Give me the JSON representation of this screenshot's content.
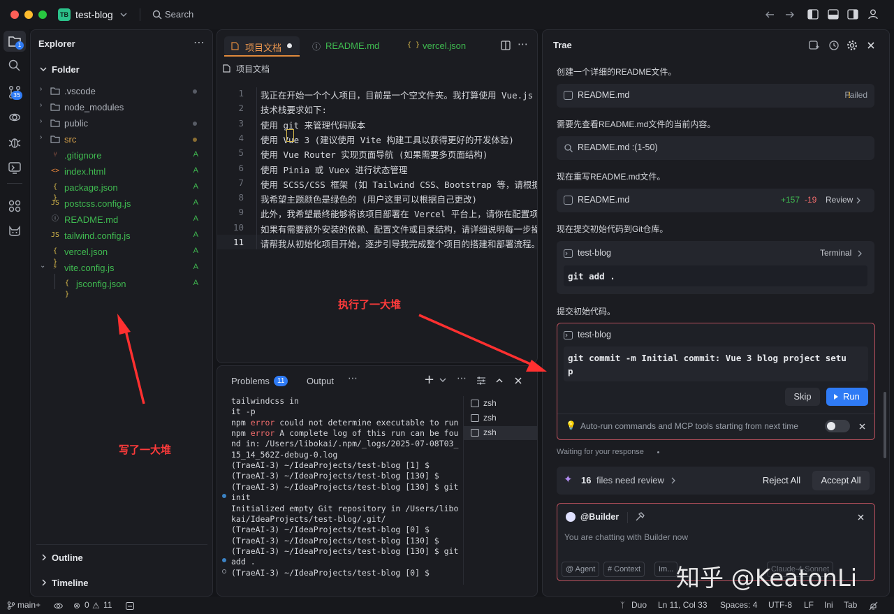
{
  "titlebar": {
    "project_initials": "TB",
    "project_name": "test-blog",
    "search_label": "Search"
  },
  "activity": {
    "explorer_badge": "1",
    "git_badge": "35"
  },
  "explorer": {
    "title": "Explorer",
    "root": "Folder",
    "items": [
      {
        "label": ".vscode",
        "icon": "folder-icon",
        "status": ""
      },
      {
        "label": "node_modules",
        "icon": "folder-icon",
        "status": ""
      },
      {
        "label": "public",
        "icon": "folder-icon",
        "status": ""
      },
      {
        "label": "src",
        "icon": "folder-icon",
        "status": ""
      },
      {
        "label": ".gitignore",
        "icon": "git-icon",
        "status": "A"
      },
      {
        "label": "index.html",
        "icon": "html-icon",
        "status": "A"
      },
      {
        "label": "package.json",
        "icon": "json-icon",
        "status": "A"
      },
      {
        "label": "postcss.config.js",
        "icon": "js-icon",
        "status": "A"
      },
      {
        "label": "README.md",
        "icon": "info-icon",
        "status": "A"
      },
      {
        "label": "tailwind.config.js",
        "icon": "js-icon",
        "status": "A"
      },
      {
        "label": "vercel.json",
        "icon": "json-icon",
        "status": "A"
      },
      {
        "label": "vite.config.js",
        "icon": "vite-icon",
        "status": "A"
      },
      {
        "label": "jsconfig.json",
        "icon": "json-icon",
        "status": "A"
      }
    ],
    "outline": "Outline",
    "timeline": "Timeline",
    "icon_glyphs": {
      "html-icon": "<>",
      "json-icon": "{ }",
      "js-icon": "JS",
      "info-icon": "ⓘ",
      "git-icon": "⑂",
      "vite-icon": "⚡"
    }
  },
  "editor": {
    "tabs": [
      {
        "label": "项目文档"
      },
      {
        "label": "README.md"
      },
      {
        "label": "vercel.json"
      }
    ],
    "breadcrumb": "项目文档",
    "lines": [
      {
        "n": "1",
        "text": "我正在开始一个个人项目，目前是一个空文件夹。我打算使用 Vue.js"
      },
      {
        "n": "2",
        "text": "技术栈要求如下:"
      },
      {
        "n": "3",
        "text": "使用 git 来管理代码版本"
      },
      {
        "n": "4",
        "text": "使用 Vue 3 (建议使用 Vite 构建工具以获得更好的开发体验)"
      },
      {
        "n": "5",
        "text": "使用 Vue Router 实现页面导航 (如果需要多页面结构)"
      },
      {
        "n": "6",
        "text": "使用 Pinia 或 Vuex 进行状态管理"
      },
      {
        "n": "7",
        "text": "使用 SCSS/CSS 框架 (如 Tailwind CSS、Bootstrap 等，请根据"
      },
      {
        "n": "8",
        "text": "我希望主题颜色是绿色的 (用户这里可以根据自己更改)"
      },
      {
        "n": "9",
        "text": "此外，我希望最终能够将该项目部署在 Vercel 平台上，请你在配置项"
      },
      {
        "n": "10",
        "text": "如果有需要额外安装的依赖、配置文件或目录结构，请详细说明每一步操"
      },
      {
        "n": "11",
        "text": "请帮我从初始化项目开始，逐步引导我完成整个项目的搭建和部署流程。"
      }
    ]
  },
  "terminal": {
    "tabs": {
      "problems": "Problems",
      "problems_count": "11",
      "output": "Output"
    },
    "shells": [
      "zsh",
      "zsh",
      "zsh"
    ],
    "lines": [
      {
        "pre": " tailwindcss in",
        "err": "",
        "post": ""
      },
      {
        "pre": "it -p",
        "err": "",
        "post": ""
      },
      {
        "pre": "npm ",
        "err": "error",
        "post": " could not determine executable to run"
      },
      {
        "pre": "npm ",
        "err": "error",
        "post": " A complete log of this run can be fou"
      },
      {
        "pre": "nd in: /Users/libokai/.npm/_logs/2025-07-08T03_",
        "err": "",
        "post": ""
      },
      {
        "pre": "15_14_562Z-debug-0.log",
        "err": "",
        "post": ""
      },
      {
        "pre": "(TraeAI-3) ~/IdeaProjects/test-blog [1] $",
        "err": "",
        "post": ""
      },
      {
        "pre": "(TraeAI-3) ~/IdeaProjects/test-blog [130] $",
        "err": "",
        "post": ""
      },
      {
        "pre": "(TraeAI-3) ~/IdeaProjects/test-blog [130] $ git",
        "err": "",
        "post": ""
      },
      {
        "pre": " init",
        "err": "",
        "post": ""
      },
      {
        "pre": "Initialized empty Git repository in /Users/libo",
        "err": "",
        "post": ""
      },
      {
        "pre": "kai/IdeaProjects/test-blog/.git/",
        "err": "",
        "post": ""
      },
      {
        "pre": "(TraeAI-3) ~/IdeaProjects/test-blog [0] $",
        "err": "",
        "post": ""
      },
      {
        "pre": "(TraeAI-3) ~/IdeaProjects/test-blog [130] $",
        "err": "",
        "post": ""
      },
      {
        "pre": "(TraeAI-3) ~/IdeaProjects/test-blog [130] $ git",
        "err": "",
        "post": ""
      },
      {
        "pre": " add .",
        "err": "",
        "post": ""
      },
      {
        "pre": "(TraeAI-3) ~/IdeaProjects/test-blog [0] $",
        "err": "",
        "post": ""
      }
    ]
  },
  "trae": {
    "title": "Trae",
    "msg1": "创建一个详细的README文件。",
    "card1": {
      "file": "README.md",
      "status": "Failed"
    },
    "msg2": "需要先查看README.md文件的当前内容。",
    "card2": {
      "file": "README.md :(1-50)"
    },
    "msg3": "现在重写README.md文件。",
    "card3": {
      "file": "README.md",
      "added": "+157",
      "removed": "-19",
      "action": "Review"
    },
    "msg4": "现在提交初始代码到Git仓库。",
    "term1": {
      "name": "test-blog",
      "action": "Terminal",
      "command": "git add ."
    },
    "msg5": "提交初始代码。",
    "term2": {
      "name": "test-blog",
      "command_line1": "git commit -m Initial commit: Vue 3 blog project setu",
      "command_line2": "p",
      "skip": "Skip",
      "run": "Run"
    },
    "autorun": "Auto-run commands and MCP tools starting from next time",
    "waiting": "Waiting for your response",
    "review": {
      "count": "16",
      "text": "files need review",
      "reject": "Reject All",
      "accept": "Accept All"
    },
    "chat": {
      "agent": "@Builder",
      "placeholder": "You are chatting with Builder now",
      "chips": [
        "@ Agent",
        "# Context",
        "Im..."
      ],
      "model": "Claude-4-Sonnet"
    }
  },
  "annotations": {
    "left": "写了一大堆",
    "middle": "执行了一大堆"
  },
  "watermark": "知乎 @KeatonLi",
  "statusbar": {
    "branch": "main+",
    "errors": "0",
    "warnings": "11",
    "duo": "Duo",
    "position": "Ln 11, Col 33",
    "spaces": "Spaces: 4",
    "encoding": "UTF-8",
    "eol": "LF",
    "lang": "Ini",
    "tab": "Tab"
  },
  "colors": {
    "accent": "#2f7bf5",
    "added": "#3fb950",
    "removed": "#f06b6b",
    "failed": "#e3b341",
    "annotation": "#ff3b3b"
  }
}
